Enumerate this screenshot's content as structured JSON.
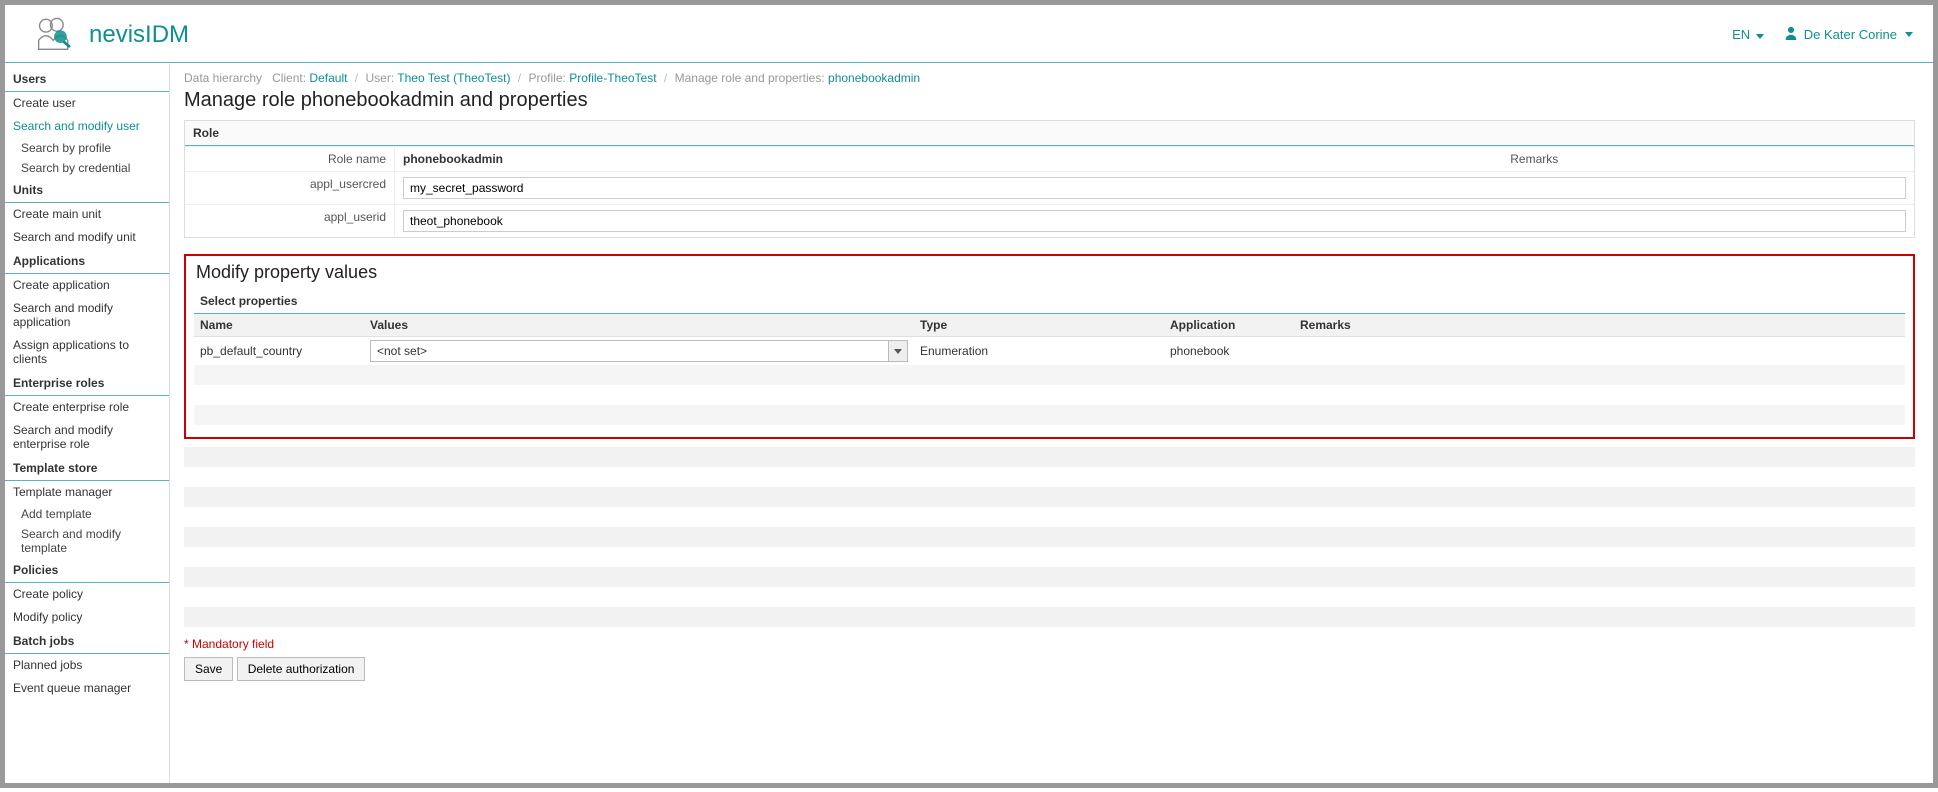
{
  "header": {
    "brand": "nevisIDM",
    "lang": "EN",
    "user": "De Kater Corine"
  },
  "sidebar": {
    "users_title": "Users",
    "users": {
      "create_user": "Create user",
      "search_modify_user": "Search and modify user",
      "search_by_profile": "Search by profile",
      "search_by_credential": "Search by credential"
    },
    "units_title": "Units",
    "units": {
      "create_main_unit": "Create main unit",
      "search_modify_unit": "Search and modify unit"
    },
    "apps_title": "Applications",
    "apps": {
      "create_app": "Create application",
      "search_modify_app": "Search and modify application",
      "assign_apps": "Assign applications to clients"
    },
    "enterprise_title": "Enterprise roles",
    "enterprise": {
      "create": "Create enterprise role",
      "search": "Search and modify enterprise role"
    },
    "template_title": "Template store",
    "template": {
      "manager": "Template manager",
      "add": "Add template",
      "search": "Search and modify template"
    },
    "policies_title": "Policies",
    "policies": {
      "create": "Create policy",
      "modify": "Modify policy"
    },
    "batch_title": "Batch jobs",
    "batch": {
      "planned": "Planned jobs",
      "queue": "Event queue manager"
    }
  },
  "breadcrumbs": {
    "root": "Data hierarchy",
    "client_label": "Client:",
    "client_link": "Default",
    "user_label": "User:",
    "user_link": "Theo Test (TheoTest)",
    "profile_label": "Profile:",
    "profile_link": "Profile-TheoTest",
    "manage_label": "Manage role and properties:",
    "manage_link": "phonebookadmin"
  },
  "page": {
    "title": "Manage role phonebookadmin and properties",
    "role_panel_title": "Role",
    "role_name_label": "Role name",
    "role_name_value": "phonebookadmin",
    "remarks_label": "Remarks",
    "appl_usercred_label": "appl_usercred",
    "appl_usercred_value": "my_secret_password",
    "appl_userid_label": "appl_userid",
    "appl_userid_value": "theot_phonebook"
  },
  "modify": {
    "section_title": "Modify property values",
    "sub_title": "Select properties",
    "columns": {
      "name": "Name",
      "values": "Values",
      "type": "Type",
      "application": "Application",
      "remarks": "Remarks"
    },
    "rows": [
      {
        "name": "pb_default_country",
        "value": "<not set>",
        "type": "Enumeration",
        "application": "phonebook",
        "remarks": ""
      }
    ]
  },
  "footer": {
    "mandatory": "Mandatory field",
    "save": "Save",
    "delete": "Delete authorization"
  }
}
